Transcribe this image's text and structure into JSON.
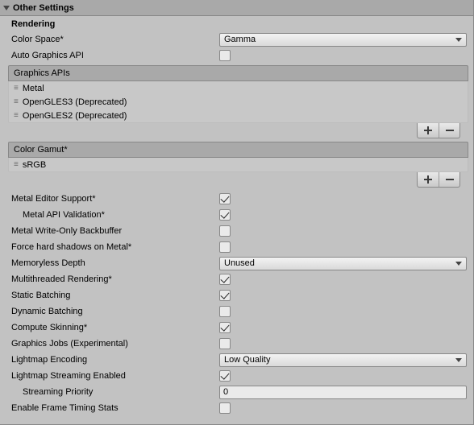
{
  "header": {
    "title": "Other Settings"
  },
  "rendering": {
    "title": "Rendering",
    "color_space": {
      "label": "Color Space*",
      "value": "Gamma"
    },
    "auto_graphics_api": {
      "label": "Auto Graphics API",
      "checked": false
    },
    "graphics_apis": {
      "title": "Graphics APIs",
      "items": [
        "Metal",
        "OpenGLES3 (Deprecated)",
        "OpenGLES2 (Deprecated)"
      ]
    },
    "color_gamut": {
      "title": "Color Gamut*",
      "items": [
        "sRGB"
      ]
    },
    "metal_editor_support": {
      "label": "Metal Editor Support*",
      "checked": true
    },
    "metal_api_validation": {
      "label": "Metal API Validation*",
      "checked": true
    },
    "metal_write_only_backbuffer": {
      "label": "Metal Write-Only Backbuffer",
      "checked": false
    },
    "force_hard_shadows_on_metal": {
      "label": "Force hard shadows on Metal*",
      "checked": false
    },
    "memoryless_depth": {
      "label": "Memoryless Depth",
      "value": "Unused"
    },
    "multithreaded_rendering": {
      "label": "Multithreaded Rendering*",
      "checked": true
    },
    "static_batching": {
      "label": "Static Batching",
      "checked": true
    },
    "dynamic_batching": {
      "label": "Dynamic Batching",
      "checked": false
    },
    "compute_skinning": {
      "label": "Compute Skinning*",
      "checked": true
    },
    "graphics_jobs": {
      "label": "Graphics Jobs (Experimental)",
      "checked": false
    },
    "lightmap_encoding": {
      "label": "Lightmap Encoding",
      "value": "Low Quality"
    },
    "lightmap_streaming_enabled": {
      "label": "Lightmap Streaming Enabled",
      "checked": true
    },
    "streaming_priority": {
      "label": "Streaming Priority",
      "value": "0"
    },
    "enable_frame_timing_stats": {
      "label": "Enable Frame Timing Stats",
      "checked": false
    }
  }
}
